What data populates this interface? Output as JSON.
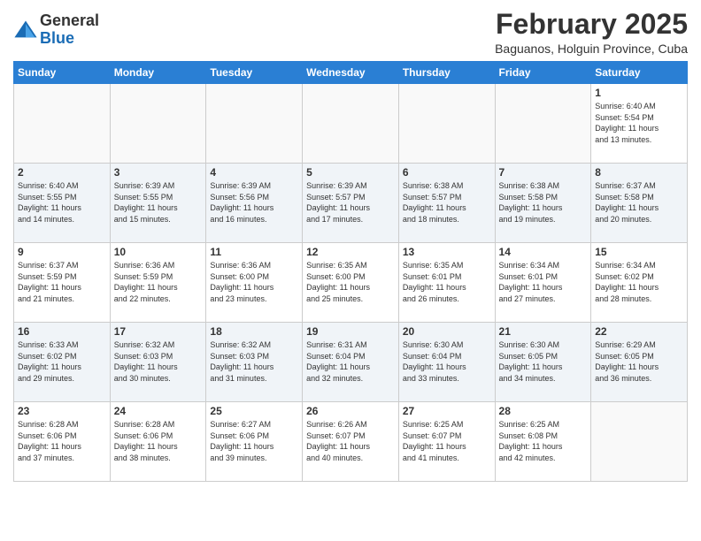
{
  "header": {
    "logo_general": "General",
    "logo_blue": "Blue",
    "main_title": "February 2025",
    "subtitle": "Baguanos, Holguin Province, Cuba"
  },
  "weekdays": [
    "Sunday",
    "Monday",
    "Tuesday",
    "Wednesday",
    "Thursday",
    "Friday",
    "Saturday"
  ],
  "weeks": [
    [
      {
        "day": "",
        "info": ""
      },
      {
        "day": "",
        "info": ""
      },
      {
        "day": "",
        "info": ""
      },
      {
        "day": "",
        "info": ""
      },
      {
        "day": "",
        "info": ""
      },
      {
        "day": "",
        "info": ""
      },
      {
        "day": "1",
        "info": "Sunrise: 6:40 AM\nSunset: 5:54 PM\nDaylight: 11 hours\nand 13 minutes."
      }
    ],
    [
      {
        "day": "2",
        "info": "Sunrise: 6:40 AM\nSunset: 5:55 PM\nDaylight: 11 hours\nand 14 minutes."
      },
      {
        "day": "3",
        "info": "Sunrise: 6:39 AM\nSunset: 5:55 PM\nDaylight: 11 hours\nand 15 minutes."
      },
      {
        "day": "4",
        "info": "Sunrise: 6:39 AM\nSunset: 5:56 PM\nDaylight: 11 hours\nand 16 minutes."
      },
      {
        "day": "5",
        "info": "Sunrise: 6:39 AM\nSunset: 5:57 PM\nDaylight: 11 hours\nand 17 minutes."
      },
      {
        "day": "6",
        "info": "Sunrise: 6:38 AM\nSunset: 5:57 PM\nDaylight: 11 hours\nand 18 minutes."
      },
      {
        "day": "7",
        "info": "Sunrise: 6:38 AM\nSunset: 5:58 PM\nDaylight: 11 hours\nand 19 minutes."
      },
      {
        "day": "8",
        "info": "Sunrise: 6:37 AM\nSunset: 5:58 PM\nDaylight: 11 hours\nand 20 minutes."
      }
    ],
    [
      {
        "day": "9",
        "info": "Sunrise: 6:37 AM\nSunset: 5:59 PM\nDaylight: 11 hours\nand 21 minutes."
      },
      {
        "day": "10",
        "info": "Sunrise: 6:36 AM\nSunset: 5:59 PM\nDaylight: 11 hours\nand 22 minutes."
      },
      {
        "day": "11",
        "info": "Sunrise: 6:36 AM\nSunset: 6:00 PM\nDaylight: 11 hours\nand 23 minutes."
      },
      {
        "day": "12",
        "info": "Sunrise: 6:35 AM\nSunset: 6:00 PM\nDaylight: 11 hours\nand 25 minutes."
      },
      {
        "day": "13",
        "info": "Sunrise: 6:35 AM\nSunset: 6:01 PM\nDaylight: 11 hours\nand 26 minutes."
      },
      {
        "day": "14",
        "info": "Sunrise: 6:34 AM\nSunset: 6:01 PM\nDaylight: 11 hours\nand 27 minutes."
      },
      {
        "day": "15",
        "info": "Sunrise: 6:34 AM\nSunset: 6:02 PM\nDaylight: 11 hours\nand 28 minutes."
      }
    ],
    [
      {
        "day": "16",
        "info": "Sunrise: 6:33 AM\nSunset: 6:02 PM\nDaylight: 11 hours\nand 29 minutes."
      },
      {
        "day": "17",
        "info": "Sunrise: 6:32 AM\nSunset: 6:03 PM\nDaylight: 11 hours\nand 30 minutes."
      },
      {
        "day": "18",
        "info": "Sunrise: 6:32 AM\nSunset: 6:03 PM\nDaylight: 11 hours\nand 31 minutes."
      },
      {
        "day": "19",
        "info": "Sunrise: 6:31 AM\nSunset: 6:04 PM\nDaylight: 11 hours\nand 32 minutes."
      },
      {
        "day": "20",
        "info": "Sunrise: 6:30 AM\nSunset: 6:04 PM\nDaylight: 11 hours\nand 33 minutes."
      },
      {
        "day": "21",
        "info": "Sunrise: 6:30 AM\nSunset: 6:05 PM\nDaylight: 11 hours\nand 34 minutes."
      },
      {
        "day": "22",
        "info": "Sunrise: 6:29 AM\nSunset: 6:05 PM\nDaylight: 11 hours\nand 36 minutes."
      }
    ],
    [
      {
        "day": "23",
        "info": "Sunrise: 6:28 AM\nSunset: 6:06 PM\nDaylight: 11 hours\nand 37 minutes."
      },
      {
        "day": "24",
        "info": "Sunrise: 6:28 AM\nSunset: 6:06 PM\nDaylight: 11 hours\nand 38 minutes."
      },
      {
        "day": "25",
        "info": "Sunrise: 6:27 AM\nSunset: 6:06 PM\nDaylight: 11 hours\nand 39 minutes."
      },
      {
        "day": "26",
        "info": "Sunrise: 6:26 AM\nSunset: 6:07 PM\nDaylight: 11 hours\nand 40 minutes."
      },
      {
        "day": "27",
        "info": "Sunrise: 6:25 AM\nSunset: 6:07 PM\nDaylight: 11 hours\nand 41 minutes."
      },
      {
        "day": "28",
        "info": "Sunrise: 6:25 AM\nSunset: 6:08 PM\nDaylight: 11 hours\nand 42 minutes."
      },
      {
        "day": "",
        "info": ""
      }
    ]
  ]
}
